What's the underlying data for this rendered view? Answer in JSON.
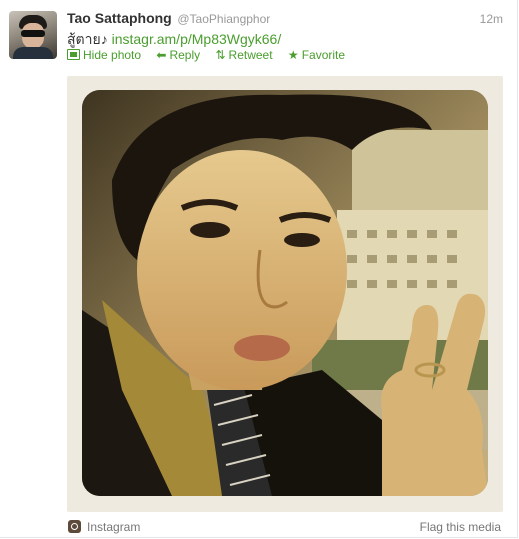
{
  "tweet": {
    "fullname": "Tao Sattaphong",
    "username": "@TaoPhiangphor",
    "time": "12m",
    "text_prefix": "สู้ตาย♪",
    "link": "instagr.am/p/Mp83Wgyk66/"
  },
  "actions": {
    "hide_photo": "Hide photo",
    "reply": "Reply",
    "retweet": "Retweet",
    "favorite": "Favorite"
  },
  "icons": [
    "photo-icon",
    "reply-icon",
    "retweet-icon",
    "star-icon",
    "instagram-icon"
  ],
  "media": {
    "source": "Instagram",
    "flag": "Flag this media"
  },
  "colors": {
    "link_green": "#4a9d2e",
    "muted": "#999999",
    "media_bg": "#efeae0"
  }
}
